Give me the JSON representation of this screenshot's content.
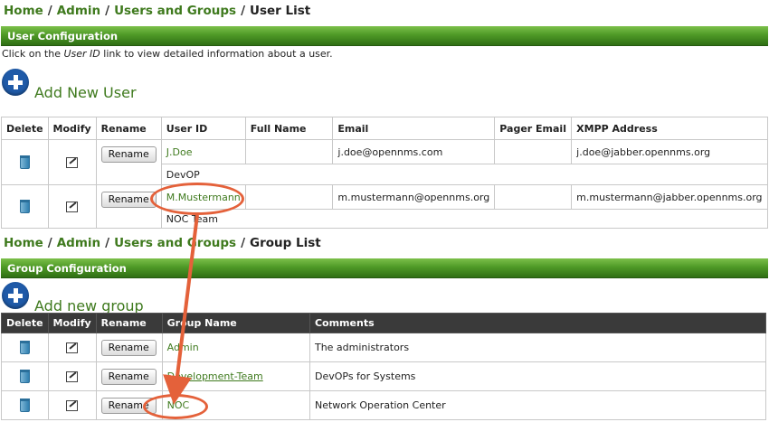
{
  "user_page": {
    "breadcrumb": {
      "home": "Home",
      "sep": "/",
      "admin": "Admin",
      "users_groups": "Users and Groups",
      "current": "User List"
    },
    "section_title": "User Configuration",
    "hint_pre": "Click on the ",
    "hint_em": "User ID",
    "hint_post": " link to view detailed information about a user.",
    "add_label": "Add New User",
    "columns": [
      "Delete",
      "Modify",
      "Rename",
      "User ID",
      "Full Name",
      "Email",
      "Pager Email",
      "XMPP Address"
    ],
    "rename_label": "Rename",
    "rows": [
      {
        "user_id": "J.Doe",
        "full_name": "",
        "email": "j.doe@opennms.com",
        "pager_email": "",
        "xmpp": "j.doe@jabber.opennms.org",
        "description": "DevOP"
      },
      {
        "user_id": "M.Mustermann",
        "full_name": "",
        "email": "m.mustermann@opennms.org",
        "pager_email": "",
        "xmpp": "m.mustermann@jabber.opennms.org",
        "description": "NOC Team"
      }
    ]
  },
  "group_page": {
    "breadcrumb": {
      "home": "Home",
      "sep": "/",
      "admin": "Admin",
      "users_groups": "Users and Groups",
      "current": "Group List"
    },
    "section_title": "Group Configuration",
    "add_label": "Add new group",
    "columns": [
      "Delete",
      "Modify",
      "Rename",
      "Group Name",
      "Comments"
    ],
    "rename_label": "Rename",
    "rows": [
      {
        "name": "Admin",
        "comment": "The administrators"
      },
      {
        "name": "Development-Team",
        "comment": "DevOPs for Systems"
      },
      {
        "name": "NOC",
        "comment": "Network Operation Center"
      }
    ]
  },
  "annotation": {
    "color": "#e4613a",
    "icons": [
      "trash-icon",
      "edit-icon",
      "add-icon"
    ]
  }
}
